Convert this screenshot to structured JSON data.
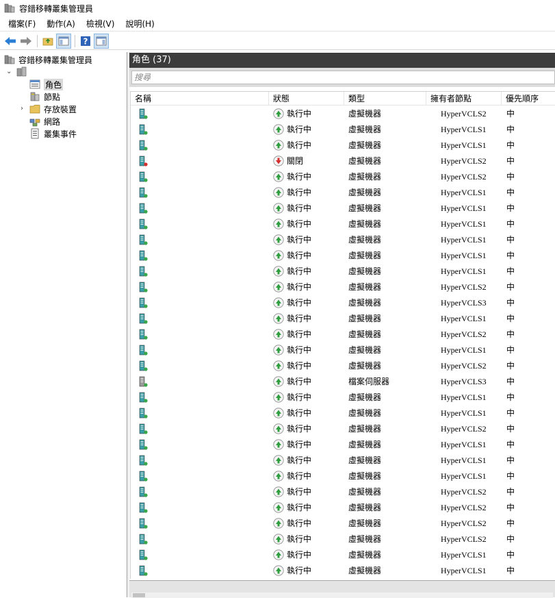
{
  "window": {
    "title": "容錯移轉叢集管理員"
  },
  "menu": {
    "items": [
      "檔案(F)",
      "動作(A)",
      "檢視(V)",
      "說明(H)"
    ]
  },
  "tree": {
    "root_label": "容錯移轉叢集管理員",
    "cluster_label": "",
    "nodes": [
      "角色",
      "節點",
      "存放裝置",
      "網路",
      "叢集事件"
    ]
  },
  "main": {
    "header_title": "角色 (37)",
    "search_placeholder": "搜尋",
    "columns": [
      "名稱",
      "狀態",
      "類型",
      "擁有者節點",
      "優先順序"
    ]
  },
  "colors": {
    "accent": "#3c3c3c",
    "running": "#2e9e3e",
    "stopped": "#d32f2f",
    "selected": "#d9d9d9"
  },
  "rows": [
    {
      "status": "執行中",
      "type": "虛擬機器",
      "owner": "HyperVCLS2",
      "priority": "中",
      "state": "running",
      "icon": "vm-icon"
    },
    {
      "status": "執行中",
      "type": "虛擬機器",
      "owner": "HyperVCLS1",
      "priority": "中",
      "state": "running",
      "icon": "vm-icon"
    },
    {
      "status": "執行中",
      "type": "虛擬機器",
      "owner": "HyperVCLS1",
      "priority": "中",
      "state": "running",
      "icon": "vm-icon"
    },
    {
      "status": "關閉",
      "type": "虛擬機器",
      "owner": "HyperVCLS2",
      "priority": "中",
      "state": "off",
      "icon": "vm-icon"
    },
    {
      "status": "執行中",
      "type": "虛擬機器",
      "owner": "HyperVCLS2",
      "priority": "中",
      "state": "running",
      "icon": "vm-icon"
    },
    {
      "status": "執行中",
      "type": "虛擬機器",
      "owner": "HyperVCLS1",
      "priority": "中",
      "state": "running",
      "icon": "vm-icon"
    },
    {
      "status": "執行中",
      "type": "虛擬機器",
      "owner": "HyperVCLS1",
      "priority": "中",
      "state": "running",
      "icon": "vm-icon"
    },
    {
      "status": "執行中",
      "type": "虛擬機器",
      "owner": "HyperVCLS1",
      "priority": "中",
      "state": "running",
      "icon": "vm-icon"
    },
    {
      "status": "執行中",
      "type": "虛擬機器",
      "owner": "HyperVCLS1",
      "priority": "中",
      "state": "running",
      "icon": "vm-icon"
    },
    {
      "status": "執行中",
      "type": "虛擬機器",
      "owner": "HyperVCLS1",
      "priority": "中",
      "state": "running",
      "icon": "vm-icon"
    },
    {
      "status": "執行中",
      "type": "虛擬機器",
      "owner": "HyperVCLS1",
      "priority": "中",
      "state": "running",
      "icon": "vm-icon"
    },
    {
      "status": "執行中",
      "type": "虛擬機器",
      "owner": "HyperVCLS2",
      "priority": "中",
      "state": "running",
      "icon": "vm-icon"
    },
    {
      "status": "執行中",
      "type": "虛擬機器",
      "owner": "HyperVCLS3",
      "priority": "中",
      "state": "running",
      "icon": "vm-icon"
    },
    {
      "status": "執行中",
      "type": "虛擬機器",
      "owner": "HyperVCLS1",
      "priority": "中",
      "state": "running",
      "icon": "vm-icon"
    },
    {
      "status": "執行中",
      "type": "虛擬機器",
      "owner": "HyperVCLS2",
      "priority": "中",
      "state": "running",
      "icon": "vm-icon"
    },
    {
      "status": "執行中",
      "type": "虛擬機器",
      "owner": "HyperVCLS1",
      "priority": "中",
      "state": "running",
      "icon": "vm-icon"
    },
    {
      "status": "執行中",
      "type": "虛擬機器",
      "owner": "HyperVCLS2",
      "priority": "中",
      "state": "running",
      "icon": "vm-icon"
    },
    {
      "status": "執行中",
      "type": "檔案伺服器",
      "owner": "HyperVCLS3",
      "priority": "中",
      "state": "running",
      "icon": "file-server-icon"
    },
    {
      "status": "執行中",
      "type": "虛擬機器",
      "owner": "HyperVCLS1",
      "priority": "中",
      "state": "running",
      "icon": "vm-icon"
    },
    {
      "status": "執行中",
      "type": "虛擬機器",
      "owner": "HyperVCLS1",
      "priority": "中",
      "state": "running",
      "icon": "vm-icon"
    },
    {
      "status": "執行中",
      "type": "虛擬機器",
      "owner": "HyperVCLS2",
      "priority": "中",
      "state": "running",
      "icon": "vm-icon"
    },
    {
      "status": "執行中",
      "type": "虛擬機器",
      "owner": "HyperVCLS1",
      "priority": "中",
      "state": "running",
      "icon": "vm-icon"
    },
    {
      "status": "執行中",
      "type": "虛擬機器",
      "owner": "HyperVCLS1",
      "priority": "中",
      "state": "running",
      "icon": "vm-icon"
    },
    {
      "status": "執行中",
      "type": "虛擬機器",
      "owner": "HyperVCLS1",
      "priority": "中",
      "state": "running",
      "icon": "vm-icon"
    },
    {
      "status": "執行中",
      "type": "虛擬機器",
      "owner": "HyperVCLS2",
      "priority": "中",
      "state": "running",
      "icon": "vm-icon"
    },
    {
      "status": "執行中",
      "type": "虛擬機器",
      "owner": "HyperVCLS2",
      "priority": "中",
      "state": "running",
      "icon": "vm-icon"
    },
    {
      "status": "執行中",
      "type": "虛擬機器",
      "owner": "HyperVCLS2",
      "priority": "中",
      "state": "running",
      "icon": "vm-icon"
    },
    {
      "status": "執行中",
      "type": "虛擬機器",
      "owner": "HyperVCLS2",
      "priority": "中",
      "state": "running",
      "icon": "vm-icon"
    },
    {
      "status": "執行中",
      "type": "虛擬機器",
      "owner": "HyperVCLS1",
      "priority": "中",
      "state": "running",
      "icon": "vm-icon"
    },
    {
      "status": "執行中",
      "type": "虛擬機器",
      "owner": "HyperVCLS1",
      "priority": "中",
      "state": "running",
      "icon": "vm-icon"
    }
  ]
}
